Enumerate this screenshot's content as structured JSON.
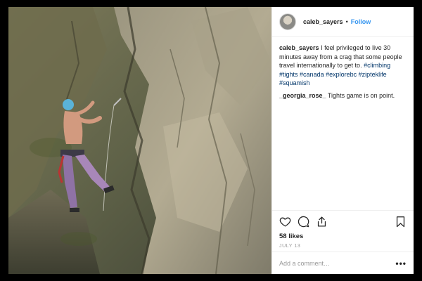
{
  "post": {
    "author": {
      "username": "caleb_sayers",
      "separator": "•",
      "follow_label": "Follow"
    },
    "caption": {
      "username": "caleb_sayers",
      "text": "I feel privileged to live 30 minutes away from a crag that some people travel internationally to get to.",
      "hashtags": [
        "#climbing",
        "#tights",
        "#canada",
        "#explorebc",
        "#zipteklife",
        "#squamish"
      ]
    },
    "comments": [
      {
        "username": "_georgia_rose_",
        "text": "Tights game is on point."
      }
    ],
    "likes": "58 likes",
    "date": "JULY 13",
    "add_comment_placeholder": "Add a comment…",
    "more_label": "•••",
    "icons": {
      "like": "heart-icon",
      "comment": "comment-icon",
      "share": "share-icon",
      "save": "bookmark-icon",
      "more": "more-options-icon"
    },
    "colors": {
      "link": "#3897f0",
      "hashtag": "#003569",
      "muted": "#999999",
      "text": "#262626"
    }
  }
}
